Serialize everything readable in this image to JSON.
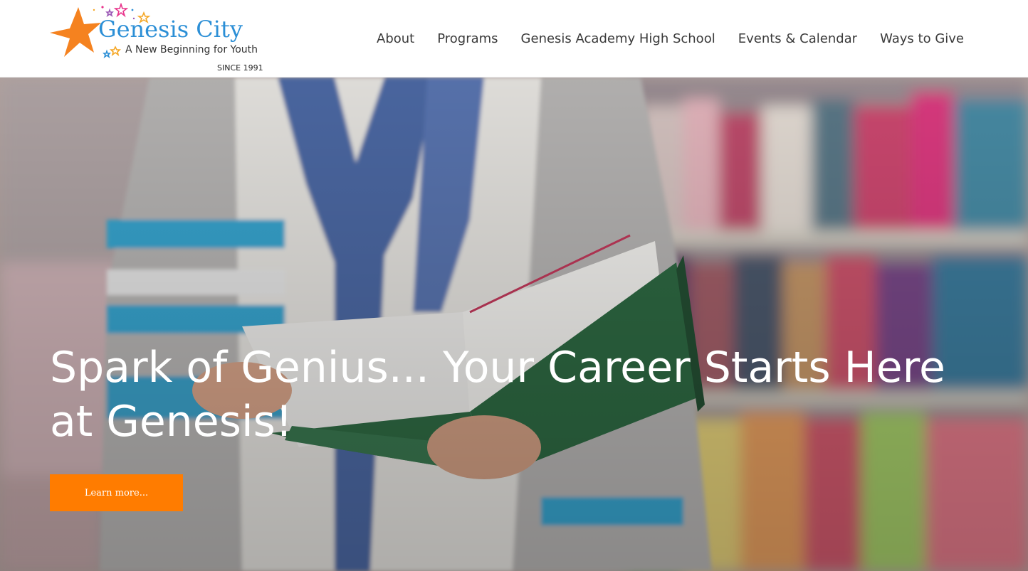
{
  "header": {
    "logo": {
      "title": "Genesis City",
      "tagline": "A New Beginning for Youth",
      "since": "SINCE 1991"
    },
    "nav": [
      {
        "label": "About"
      },
      {
        "label": "Programs"
      },
      {
        "label": "Genesis Academy High School"
      },
      {
        "label": "Events & Calendar"
      },
      {
        "label": "Ways to Give"
      }
    ]
  },
  "hero": {
    "headline": "Spark of Genius... Your Career Starts Here at Genesis!",
    "cta_label": "Learn more..."
  },
  "colors": {
    "accent_orange": "#ff7c00",
    "logo_blue": "#2c8fd6",
    "nav_text": "#3a3a3a",
    "hero_text": "#ffffff"
  },
  "icons": {
    "logo_mark": "star-cluster-icon"
  }
}
